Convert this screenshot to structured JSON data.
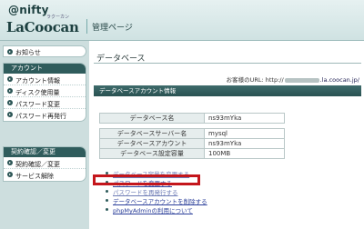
{
  "header": {
    "nifty_logo": "@nifty",
    "brand": "LaCoocan",
    "brand_kana": "ラクーカン",
    "title": "管理ページ"
  },
  "sidebar": {
    "home": "お知らせ",
    "sections": [
      {
        "heading": "アカウント",
        "items": [
          "アカウント情報",
          "ディスク使用量",
          "パスワード変更",
          "パスワード再発行"
        ]
      },
      {
        "heading": "契約確認／変更",
        "items": [
          "契約確認／変更",
          "サービス解除"
        ]
      }
    ]
  },
  "main": {
    "title": "データベース",
    "url_label": "お客様のURL: http://",
    "url_suffix": ".la.coocan.jp/",
    "section_heading": "データベースアカウント情報",
    "table1": [
      {
        "key": "データベース名",
        "value": "ns93mYka"
      }
    ],
    "table2": [
      {
        "key": "データベースサーバー名",
        "value": "mysql"
      },
      {
        "key": "データベースアカウント",
        "value": "ns93mYka"
      },
      {
        "key": "データベース設定容量",
        "value": "100MB"
      }
    ],
    "links": [
      "データベース容量を変更する",
      "パスワードを変更する",
      "パスワードを再発行する",
      "データベースアカウントを削除する",
      "phpMyAdminの利用について"
    ]
  },
  "colors": {
    "accent": "#2f5c5c",
    "highlight": "#c4161c",
    "link": "#2b3f9a"
  }
}
